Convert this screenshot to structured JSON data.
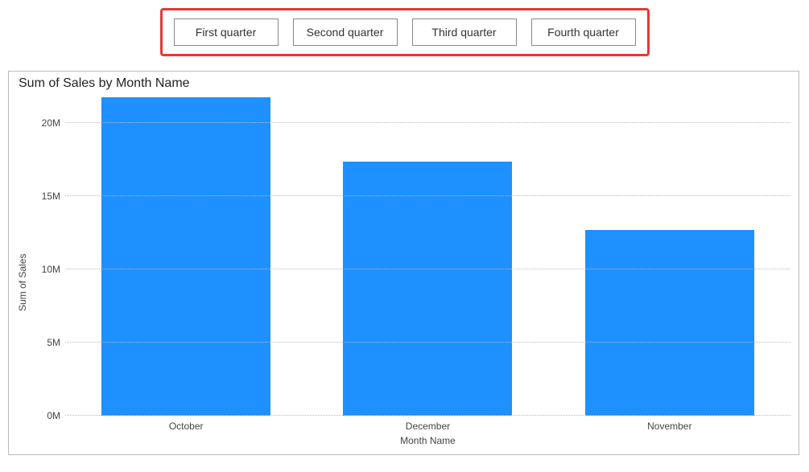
{
  "slicer": {
    "items": [
      "First quarter",
      "Second quarter",
      "Third quarter",
      "Fourth quarter"
    ]
  },
  "chart_data": {
    "type": "bar",
    "title": "Sum of Sales by Month Name",
    "xlabel": "Month Name",
    "ylabel": "Sum of Sales",
    "categories": [
      "October",
      "December",
      "November"
    ],
    "values": [
      21800000,
      17400000,
      12700000
    ],
    "ylim": [
      0,
      22000000
    ],
    "yticks": [
      0,
      5000000,
      10000000,
      15000000,
      20000000
    ],
    "ytick_labels": [
      "0M",
      "5M",
      "10M",
      "15M",
      "20M"
    ],
    "bar_color": "#1e90ff",
    "grid": true
  }
}
